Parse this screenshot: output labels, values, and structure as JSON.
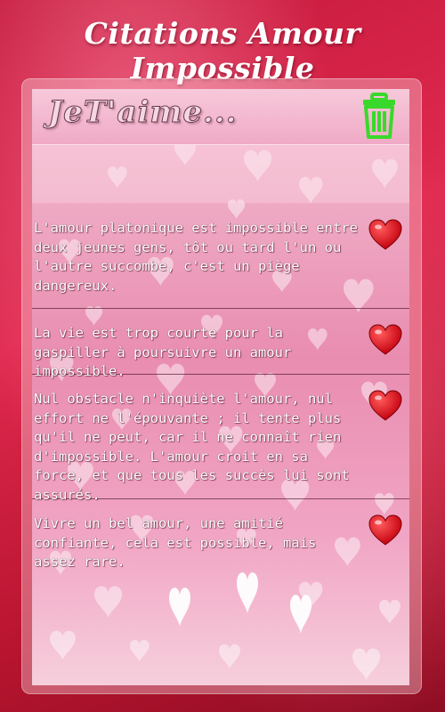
{
  "app": {
    "title": "Citations Amour Impossible"
  },
  "header": {
    "logo_text": "JeT'aime...",
    "delete_icon": "trash-icon"
  },
  "quotes": [
    {
      "text": "L'amour platonique est impossible entre deux jeunes gens, tôt ou tard l'un ou l'autre succombe, c'est un piège dangereux.",
      "icon": "heart-icon"
    },
    {
      "text": "La vie est trop courte pour la gaspiller à poursuivre un amour impossible.",
      "icon": "heart-icon"
    },
    {
      "text": "Nul obstacle n'inquiète l'amour, nul effort ne l'épouvante ; il tente plus qu'il ne peut, car il ne connaît rien d'impossible. L'amour croit en sa force, et que tous les succès lui sont assurés.",
      "icon": "heart-icon"
    },
    {
      "text": "Vivre un bel amour, une amitié confiante, cela est possible, mais assez rare.",
      "icon": "heart-icon"
    }
  ],
  "colors": {
    "background": "#c41a3c",
    "panel": "#e98db0",
    "heart_red": "#e0001a",
    "trash_green": "#39d92b"
  }
}
